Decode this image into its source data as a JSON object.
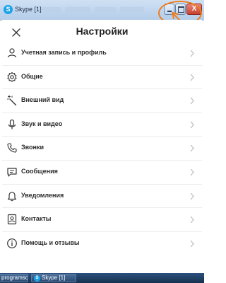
{
  "window": {
    "title": "Skype [1]",
    "logo_letter": "S",
    "close_glyph": "X"
  },
  "settings": {
    "title": "Настройки",
    "items": [
      {
        "label": "Учетная запись и профиль",
        "icon": "person-icon"
      },
      {
        "label": "Общие",
        "icon": "gear-icon"
      },
      {
        "label": "Внешний вид",
        "icon": "magic-wand-icon"
      },
      {
        "label": "Звук и видео",
        "icon": "microphone-icon"
      },
      {
        "label": "Звонки",
        "icon": "phone-icon"
      },
      {
        "label": "Сообщения",
        "icon": "message-icon"
      },
      {
        "label": "Уведомления",
        "icon": "bell-icon"
      },
      {
        "label": "Контакты",
        "icon": "contacts-icon"
      },
      {
        "label": "Помощь и отзывы",
        "icon": "info-icon"
      }
    ]
  },
  "taskbar": {
    "items": [
      "programso...",
      "Skype [1]"
    ]
  },
  "colors": {
    "accent_annotation": "#f07d1e",
    "close_button": "#c9412f",
    "skype_blue": "#1aa3e8"
  }
}
